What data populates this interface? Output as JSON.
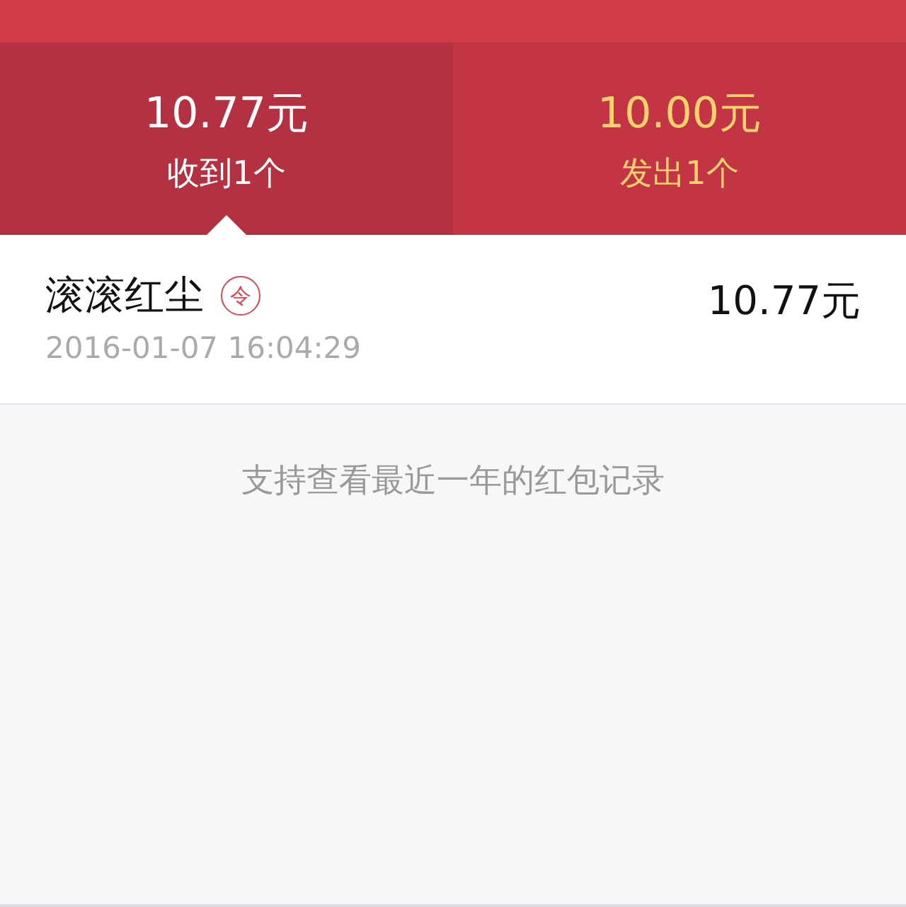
{
  "tabs": [
    {
      "amount": "10.77元",
      "label": "收到1个",
      "selected": true
    },
    {
      "amount": "10.00元",
      "label": "发出1个",
      "selected": false
    }
  ],
  "records": [
    {
      "name": "滚滚红尘",
      "badge": "令",
      "time": "2016-01-07 16:04:29",
      "amount": "10.77元"
    }
  ],
  "note": "支持查看最近一年的红包记录"
}
